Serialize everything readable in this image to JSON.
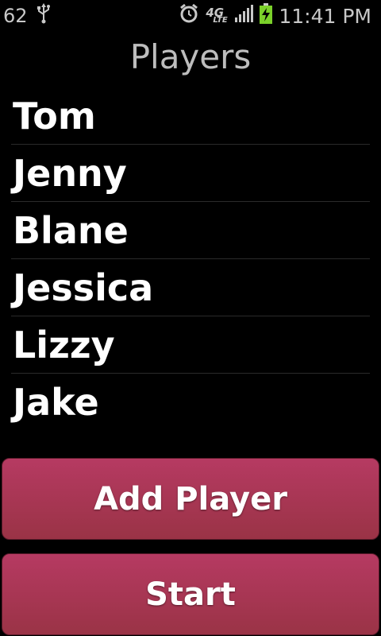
{
  "statusbar": {
    "left_number": "62",
    "network_label": "4G",
    "network_sub": "LTE",
    "time": "11:41 PM",
    "icons": [
      "usb-icon",
      "alarm-icon",
      "signal-icon",
      "battery-charging-icon"
    ]
  },
  "header": {
    "title": "Players"
  },
  "players": {
    "items": [
      "Tom",
      "Jenny",
      "Blane",
      "Jessica",
      "Lizzy",
      "Jake"
    ]
  },
  "buttons": {
    "add_label": "Add Player",
    "start_label": "Start"
  },
  "colors": {
    "button_top": "#b63a62",
    "button_bottom": "#9a3346",
    "title": "#bdbdbd",
    "battery": "#7bd12a"
  }
}
